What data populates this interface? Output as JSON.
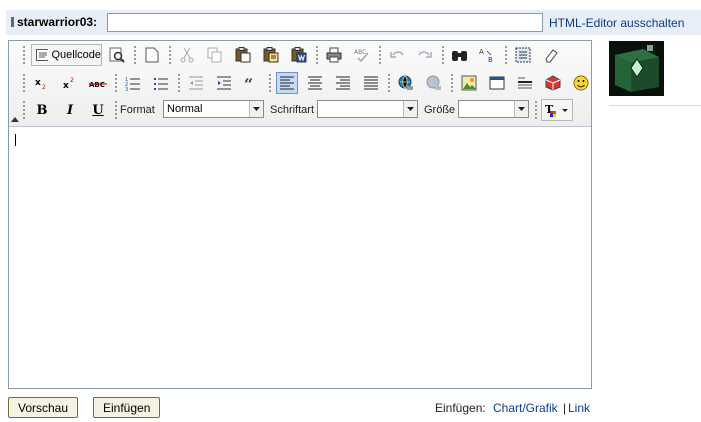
{
  "header": {
    "author": "starwarrior03",
    "author_suffix": ":",
    "subject_value": "",
    "toggle_link": "HTML-Editor ausschalten"
  },
  "toolbar": {
    "source_label": "Quellcode",
    "format_label": "Format",
    "format_value": "Normal",
    "font_label": "Schriftart",
    "font_value": "",
    "size_label": "Größe",
    "size_value": "",
    "bold": "B",
    "italic": "I",
    "underline": "U",
    "active_align": "left"
  },
  "editor": {
    "content": ""
  },
  "footer": {
    "preview_button": "Vorschau",
    "insert_button": "Einfügen",
    "insert_label": "Einfügen:",
    "chart_link": "Chart/Grafik",
    "separator": "|",
    "link_link": "Link"
  },
  "colors": {
    "link": "#0b3b8c",
    "header_bg": "#e8eef7",
    "active_button": "#c6d9f5"
  }
}
